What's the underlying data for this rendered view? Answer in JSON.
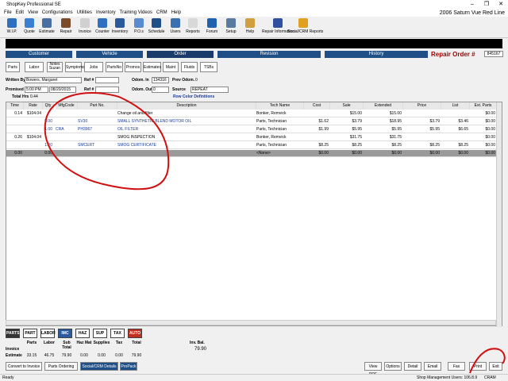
{
  "title": "ShopKey Professional SE",
  "window_controls": {
    "minimize": "–",
    "maximize": "❐",
    "close": "✕"
  },
  "menu": [
    "File",
    "Edit",
    "View",
    "Configurations",
    "Utilities",
    "Inventory",
    "Training Videos",
    "CRM",
    "Help"
  ],
  "vehicle": "2006  Saturn  Vue  Red Line",
  "toolbar": [
    {
      "label": "W.I.P.",
      "icon": "wip-icon",
      "color": "#2f6fbf"
    },
    {
      "label": "Quote",
      "icon": "quote-icon",
      "color": "#3b7fd0"
    },
    {
      "label": "Estimate",
      "icon": "estimate-icon",
      "color": "#4a6fa0"
    },
    {
      "label": "Repair",
      "icon": "repair-icon",
      "color": "#7a4a2a"
    },
    {
      "label": "Invoice",
      "icon": "invoice-icon",
      "color": "#d0d0d0"
    },
    {
      "label": "Counter",
      "icon": "counter-icon",
      "color": "#3070c0"
    },
    {
      "label": "Inventory",
      "icon": "inventory-icon",
      "color": "#2a5a9a"
    },
    {
      "label": "P.O.s",
      "icon": "pos-icon",
      "color": "#5a8ad0"
    },
    {
      "label": "Schedule",
      "icon": "schedule-icon",
      "color": "#1f4f86"
    },
    {
      "label": "Users",
      "icon": "users-icon",
      "color": "#3a6fb0"
    },
    {
      "label": "Reports",
      "icon": "reports-icon",
      "color": "#d8d8d8"
    },
    {
      "label": "Forum",
      "icon": "forum-icon",
      "color": "#2060b0"
    },
    {
      "label": "Setup",
      "icon": "setup-icon",
      "color": "#5a7aa0"
    },
    {
      "label": "Help",
      "icon": "help-icon",
      "color": "#d0a040"
    },
    {
      "label": "Repair Information",
      "icon": "repair-information-icon",
      "color": "#3050a0"
    },
    {
      "label": "Social/CRM Reports",
      "icon": "social-crm-reports-icon",
      "color": "#e0a020"
    }
  ],
  "nav_tabs": [
    "Customer",
    "Vehicle",
    "Order",
    "Revision",
    "History"
  ],
  "repair_order": {
    "label": "Repair Order #",
    "number": "845167"
  },
  "sub_tabs": [
    "Parts",
    "Labor",
    "Notes Suzan",
    "Symptoms",
    "Jobs",
    "PartsNo",
    "Promos",
    "Estimates",
    "Maint",
    "Fluids",
    "TSBs"
  ],
  "form": {
    "written_by_label": "Written By",
    "written_by": "Bowers, Margaret",
    "ref1_label": "Ref #",
    "ref1": "",
    "promised_label": "Promised",
    "promised_time": "5:00 PM",
    "promised_date": "08/20/2015",
    "ref2_label": "Ref #",
    "ref2": "",
    "total_hrs_label": "Total Hrs",
    "total_hrs": "0.44",
    "odom_in_label": "Odom. In",
    "odom_in": "134316",
    "prev_odom_label": "Prev Odom.",
    "prev_odom": "0",
    "odom_out_label": "Odom. Out",
    "odom_out": "0",
    "source_label": "Source",
    "source": "REPEAT",
    "row_color_link": "Row Color Definitions"
  },
  "grid": {
    "headers": [
      "Time",
      "Rate",
      "Qty",
      "MfgCode",
      "Part No.",
      "Description",
      "Tech Name",
      "Cost",
      "Sale",
      "Extended",
      "Price",
      "List",
      "Ext. Parts"
    ],
    "rows": [
      {
        "time": "0.14",
        "rate": "$104.04",
        "qty": "",
        "mfg": "",
        "part": "",
        "desc": "Change oil and filter",
        "tech": "Bonker, Remvick",
        "cost": "",
        "sale": "$15.00",
        "ext": "$15.00",
        "price": "",
        "list": "",
        "extparts": "$0.00",
        "blue": false
      },
      {
        "time": "",
        "rate": "",
        "qty": "5.00",
        "mfg": "",
        "part": "SV30",
        "desc": "SMALL SYNTHETIC BLEND MOTOR OIL",
        "tech": "Parts, Technician",
        "cost": "$1.62",
        "sale": "$3.79",
        "ext": "$18.95",
        "price": "$3.79",
        "list": "$3.46",
        "extparts": "$0.00",
        "blue": true
      },
      {
        "time": "",
        "rate": "",
        "qty": "1.00",
        "mfg": "CRA",
        "part": "PH3967",
        "desc": "OIL FILTER",
        "tech": "Parts, Technician",
        "cost": "$1.99",
        "sale": "$5.95",
        "ext": "$5.95",
        "price": "$5.95",
        "list": "$6.65",
        "extparts": "$0.00",
        "blue": true
      },
      {
        "time": "0.26",
        "rate": "$104.04",
        "qty": "",
        "mfg": "",
        "part": "",
        "desc": "SMOG INSPECTION",
        "tech": "Bonker, Remvick",
        "cost": "",
        "sale": "$31.75",
        "ext": "$31.75",
        "price": "",
        "list": "",
        "extparts": "$0.00",
        "blue": false
      },
      {
        "time": "",
        "rate": "",
        "qty": "1.00",
        "mfg": "",
        "part": "SMCERT",
        "desc": "SMOG CERTIFICATE",
        "tech": "Parts, Technician",
        "cost": "$8.25",
        "sale": "$8.25",
        "ext": "$8.25",
        "price": "$8.25",
        "list": "$8.25",
        "extparts": "$0.00",
        "blue": true
      }
    ],
    "total_row": {
      "time": "0.00",
      "qty": "0.00",
      "tech": "<None>",
      "cost": "$0.00",
      "sale": "$0.00",
      "ext": "$0.00",
      "price": "$0.00",
      "list": "$0.00",
      "extparts": "$0.00"
    }
  },
  "summary": {
    "logos": [
      "PARTS",
      "PART",
      "LABOR",
      "IMC",
      "HAZ",
      "SUP",
      "TAX",
      "AUTO"
    ],
    "labels": [
      "Parts",
      "Labor",
      "Sub Total",
      "Haz Mat",
      "Supplies",
      "Tax",
      "Total"
    ],
    "invoice_label": "Invoice",
    "estimate_label": "Estimate",
    "invoice_values": [
      "33.15",
      "46.75",
      "79.90",
      "0.00",
      "0.00",
      "0.00",
      "79.90"
    ],
    "inv_bal_label": "Inv. Bal.",
    "inv_bal": "79.90"
  },
  "bottom_buttons": {
    "left": [
      "Convert to Invoice",
      "Parts Ordering",
      "Social/CRM Details",
      "ProPack"
    ],
    "right": [
      "View PDF",
      "Options",
      "Detail",
      "Email",
      "Fax",
      "Print",
      "Exit"
    ]
  },
  "status": {
    "left": "Ready",
    "users": "Shop Management Users: 10",
    "version": "6.8.9",
    "mode": "CRAM"
  }
}
